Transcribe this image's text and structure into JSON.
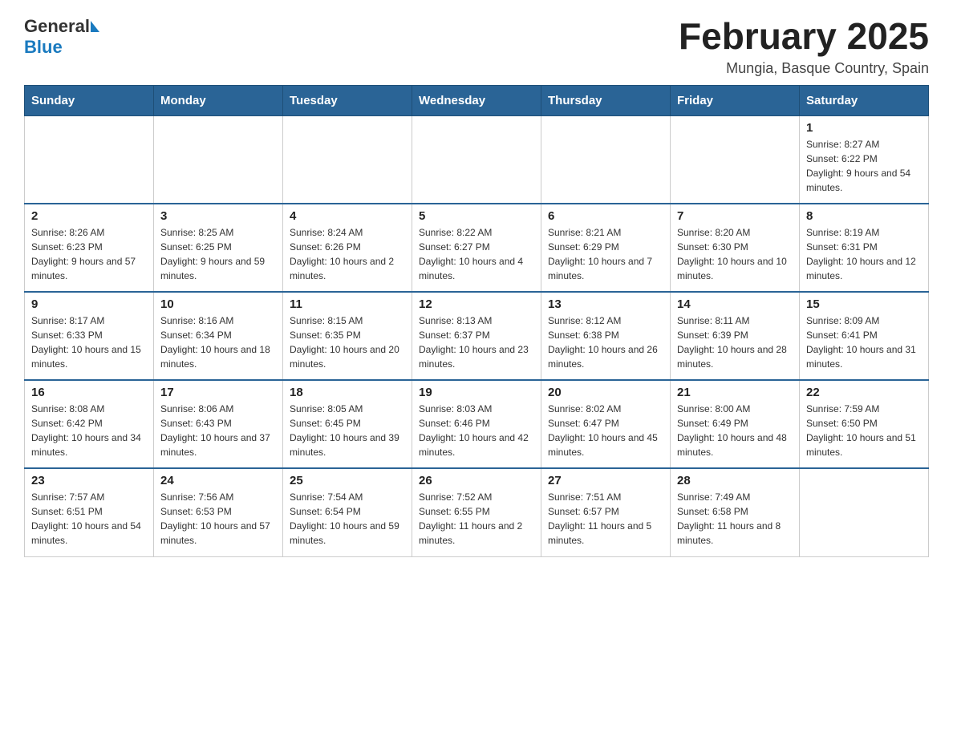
{
  "header": {
    "title": "February 2025",
    "subtitle": "Mungia, Basque Country, Spain",
    "logo_general": "General",
    "logo_blue": "Blue"
  },
  "days_of_week": [
    "Sunday",
    "Monday",
    "Tuesday",
    "Wednesday",
    "Thursday",
    "Friday",
    "Saturday"
  ],
  "weeks": [
    [
      {
        "day": "",
        "info": ""
      },
      {
        "day": "",
        "info": ""
      },
      {
        "day": "",
        "info": ""
      },
      {
        "day": "",
        "info": ""
      },
      {
        "day": "",
        "info": ""
      },
      {
        "day": "",
        "info": ""
      },
      {
        "day": "1",
        "info": "Sunrise: 8:27 AM\nSunset: 6:22 PM\nDaylight: 9 hours and 54 minutes."
      }
    ],
    [
      {
        "day": "2",
        "info": "Sunrise: 8:26 AM\nSunset: 6:23 PM\nDaylight: 9 hours and 57 minutes."
      },
      {
        "day": "3",
        "info": "Sunrise: 8:25 AM\nSunset: 6:25 PM\nDaylight: 9 hours and 59 minutes."
      },
      {
        "day": "4",
        "info": "Sunrise: 8:24 AM\nSunset: 6:26 PM\nDaylight: 10 hours and 2 minutes."
      },
      {
        "day": "5",
        "info": "Sunrise: 8:22 AM\nSunset: 6:27 PM\nDaylight: 10 hours and 4 minutes."
      },
      {
        "day": "6",
        "info": "Sunrise: 8:21 AM\nSunset: 6:29 PM\nDaylight: 10 hours and 7 minutes."
      },
      {
        "day": "7",
        "info": "Sunrise: 8:20 AM\nSunset: 6:30 PM\nDaylight: 10 hours and 10 minutes."
      },
      {
        "day": "8",
        "info": "Sunrise: 8:19 AM\nSunset: 6:31 PM\nDaylight: 10 hours and 12 minutes."
      }
    ],
    [
      {
        "day": "9",
        "info": "Sunrise: 8:17 AM\nSunset: 6:33 PM\nDaylight: 10 hours and 15 minutes."
      },
      {
        "day": "10",
        "info": "Sunrise: 8:16 AM\nSunset: 6:34 PM\nDaylight: 10 hours and 18 minutes."
      },
      {
        "day": "11",
        "info": "Sunrise: 8:15 AM\nSunset: 6:35 PM\nDaylight: 10 hours and 20 minutes."
      },
      {
        "day": "12",
        "info": "Sunrise: 8:13 AM\nSunset: 6:37 PM\nDaylight: 10 hours and 23 minutes."
      },
      {
        "day": "13",
        "info": "Sunrise: 8:12 AM\nSunset: 6:38 PM\nDaylight: 10 hours and 26 minutes."
      },
      {
        "day": "14",
        "info": "Sunrise: 8:11 AM\nSunset: 6:39 PM\nDaylight: 10 hours and 28 minutes."
      },
      {
        "day": "15",
        "info": "Sunrise: 8:09 AM\nSunset: 6:41 PM\nDaylight: 10 hours and 31 minutes."
      }
    ],
    [
      {
        "day": "16",
        "info": "Sunrise: 8:08 AM\nSunset: 6:42 PM\nDaylight: 10 hours and 34 minutes."
      },
      {
        "day": "17",
        "info": "Sunrise: 8:06 AM\nSunset: 6:43 PM\nDaylight: 10 hours and 37 minutes."
      },
      {
        "day": "18",
        "info": "Sunrise: 8:05 AM\nSunset: 6:45 PM\nDaylight: 10 hours and 39 minutes."
      },
      {
        "day": "19",
        "info": "Sunrise: 8:03 AM\nSunset: 6:46 PM\nDaylight: 10 hours and 42 minutes."
      },
      {
        "day": "20",
        "info": "Sunrise: 8:02 AM\nSunset: 6:47 PM\nDaylight: 10 hours and 45 minutes."
      },
      {
        "day": "21",
        "info": "Sunrise: 8:00 AM\nSunset: 6:49 PM\nDaylight: 10 hours and 48 minutes."
      },
      {
        "day": "22",
        "info": "Sunrise: 7:59 AM\nSunset: 6:50 PM\nDaylight: 10 hours and 51 minutes."
      }
    ],
    [
      {
        "day": "23",
        "info": "Sunrise: 7:57 AM\nSunset: 6:51 PM\nDaylight: 10 hours and 54 minutes."
      },
      {
        "day": "24",
        "info": "Sunrise: 7:56 AM\nSunset: 6:53 PM\nDaylight: 10 hours and 57 minutes."
      },
      {
        "day": "25",
        "info": "Sunrise: 7:54 AM\nSunset: 6:54 PM\nDaylight: 10 hours and 59 minutes."
      },
      {
        "day": "26",
        "info": "Sunrise: 7:52 AM\nSunset: 6:55 PM\nDaylight: 11 hours and 2 minutes."
      },
      {
        "day": "27",
        "info": "Sunrise: 7:51 AM\nSunset: 6:57 PM\nDaylight: 11 hours and 5 minutes."
      },
      {
        "day": "28",
        "info": "Sunrise: 7:49 AM\nSunset: 6:58 PM\nDaylight: 11 hours and 8 minutes."
      },
      {
        "day": "",
        "info": ""
      }
    ]
  ]
}
